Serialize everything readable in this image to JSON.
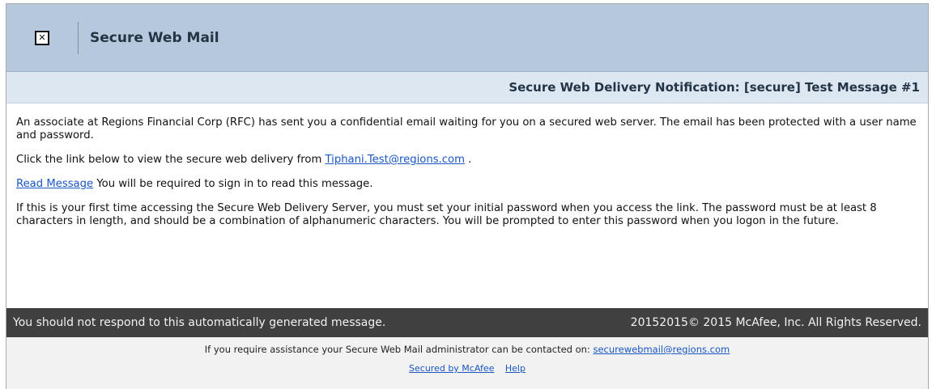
{
  "header": {
    "icon": "close-box-icon",
    "title": "Secure Web Mail"
  },
  "subheader": {
    "subject": "Secure Web Delivery Notification: [secure] Test Message #1"
  },
  "body": {
    "para1": "An associate at Regions Financial Corp (RFC) has sent you a confidential email waiting for you on a secured web server. The email has been protected with a user name and password.",
    "para2_prefix": "Click the link below to view the secure web delivery from ",
    "sender_email": "Tiphani.Test@regions.com",
    "para2_suffix": " .",
    "read_message_link": "Read Message",
    "para3_suffix": " You will be required to sign in to read this message.",
    "para4": "If this is your first time accessing the Secure Web Delivery Server, you must set your initial password when you access the link. The password must be at least 8 characters in length, and should be a combination of alphanumeric characters. You will be prompted to enter this password when you logon in the future."
  },
  "darkbar": {
    "left_text": "You should not respond to this automatically generated message.",
    "right_text": "20152015© 2015 McAfee, Inc. All Rights Reserved."
  },
  "footer": {
    "assist_text": "If you require assistance your Secure Web Mail administrator can be contacted on: ",
    "admin_email": "securewebmail@regions.com",
    "secured_by_link": "Secured by McAfee",
    "help_link": "Help"
  },
  "colors": {
    "header_bg": "#b5c8dc",
    "subheader_bg": "#dde7f1",
    "darkbar_bg": "#404040",
    "link": "#1a56c4"
  }
}
